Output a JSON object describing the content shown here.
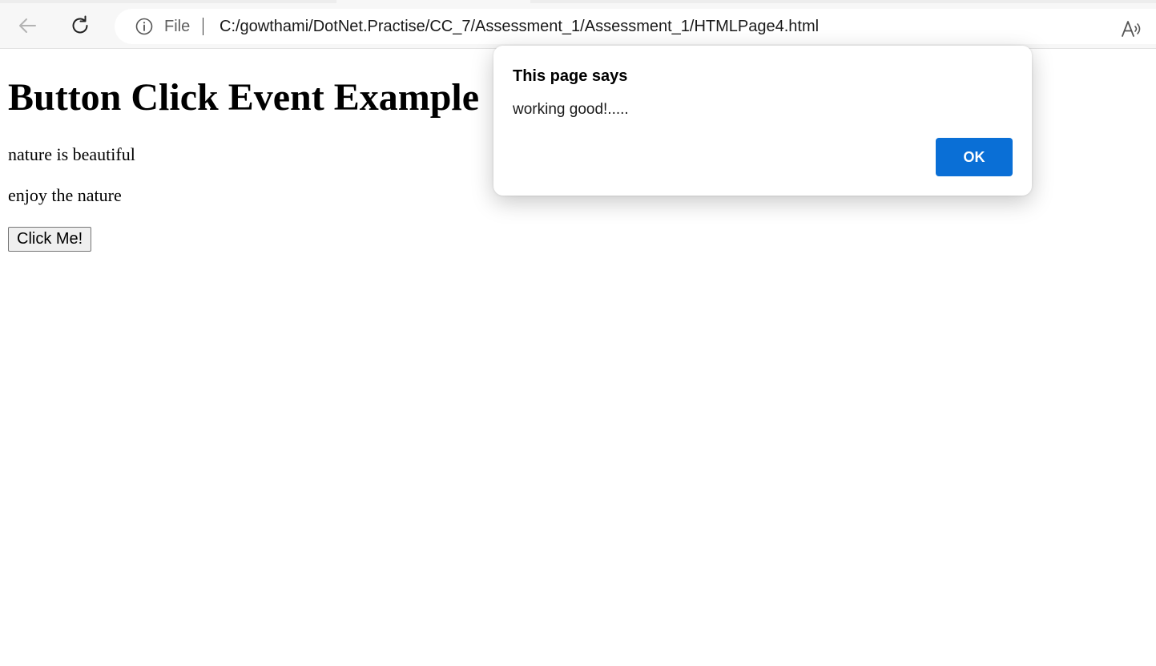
{
  "browser": {
    "address_bar": {
      "scheme_label": "File",
      "url": "C:/gowthami/DotNet.Practise/CC_7/Assessment_1/Assessment_1/HTMLPage4.html"
    },
    "icons": {
      "back": "arrow-left",
      "reload": "refresh",
      "site_info": "info-circle",
      "read_aloud": "read-aloud"
    }
  },
  "page": {
    "heading": "Button Click Event Example",
    "paragraphs": [
      "nature is beautiful",
      "enjoy the nature"
    ],
    "button_label": "Click Me!"
  },
  "dialog": {
    "title": "This page says",
    "message": "working good!.....",
    "ok_label": "OK",
    "ok_color": "#0a6fd6"
  }
}
